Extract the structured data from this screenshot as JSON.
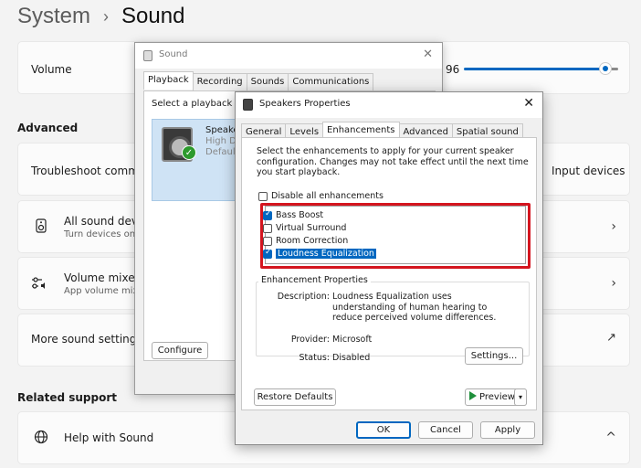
{
  "settings": {
    "breadcrumb_parent": "System",
    "breadcrumb_sep": "›",
    "page_title": "Sound",
    "volume_label": "Volume",
    "volume_value": "96",
    "volume_fraction": 0.96,
    "advanced_heading": "Advanced",
    "troubleshoot_label": "Troubleshoot commo",
    "input_devices_link": "Input devices",
    "all_devices_title": "All sound devic",
    "all_devices_sub": "Turn devices on/",
    "mixer_title": "Volume mixer",
    "mixer_sub": "App volume mix,",
    "more_settings": "More sound settings",
    "related_heading": "Related support",
    "help_label": "Help with Sound",
    "chevron": "›",
    "chevron_up": "^",
    "external_icon": "↗"
  },
  "sound_dialog": {
    "title": "Sound",
    "close": "✕",
    "tabs": [
      "Playback",
      "Recording",
      "Sounds",
      "Communications"
    ],
    "prompt": "Select a playback dev",
    "device_name": "Speaker",
    "device_driver": "High De",
    "device_status": "Default",
    "configure_button": "Configure"
  },
  "props_dialog": {
    "title": "Speakers Properties",
    "close": "✕",
    "tabs": [
      "General",
      "Levels",
      "Enhancements",
      "Advanced",
      "Spatial sound"
    ],
    "intro": "Select the enhancements to apply for your current speaker configuration. Changes may not take effect until the next time you start playback.",
    "disable_all": "Disable all enhancements",
    "enhancements": [
      {
        "label": "Bass Boost",
        "checked": true
      },
      {
        "label": "Virtual Surround",
        "checked": false
      },
      {
        "label": "Room Correction",
        "checked": false
      },
      {
        "label": "Loudness Equalization",
        "checked": true
      }
    ],
    "group_label": "Enhancement Properties",
    "description_key": "Description:",
    "description_val": "Loudness Equalization uses understanding of human hearing to reduce perceived volume differences.",
    "provider_key": "Provider:",
    "provider_val": "Microsoft",
    "status_key": "Status:",
    "status_val": "Disabled",
    "settings_button": "Settings...",
    "restore_button": "Restore Defaults",
    "preview_button": "Preview",
    "ok_button": "OK",
    "cancel_button": "Cancel",
    "apply_button": "Apply",
    "accent": "#0067c0",
    "highlight_border": "#d4151f"
  }
}
